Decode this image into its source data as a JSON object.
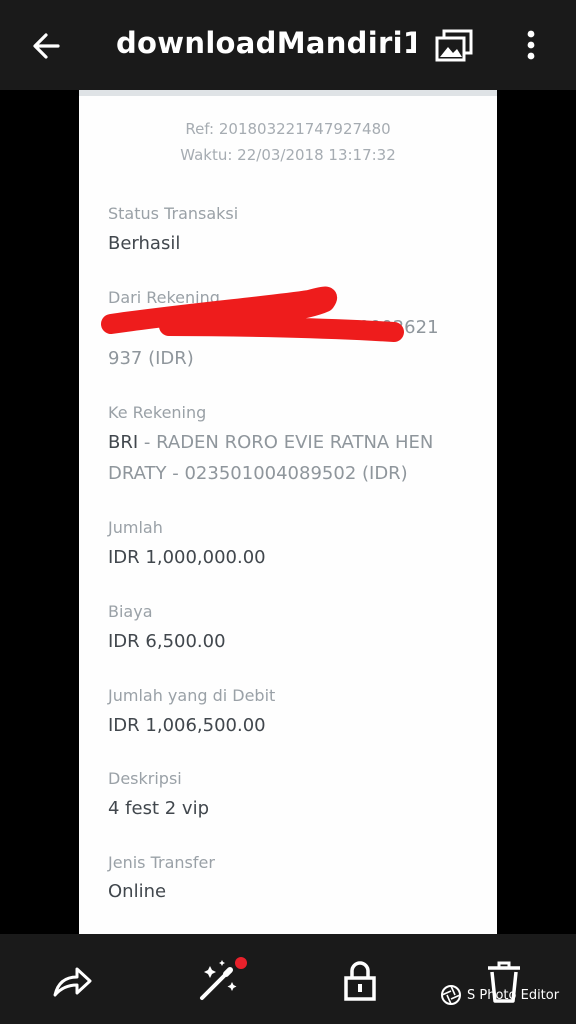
{
  "topbar": {
    "title": "downloadMandiri1...",
    "back_icon": "arrow-left-icon",
    "gallery_icon": "gallery-icon",
    "more_icon": "more-vertical-icon"
  },
  "receipt": {
    "ref": "Ref: 201803221747927480",
    "waktu": "Waktu: 22/03/2018 13:17:32",
    "fields": [
      {
        "label": "Status Transaksi",
        "value": "Berhasil"
      },
      {
        "label": "Dari Rekening",
        "value_line1": "1540002621",
        "value_line2": "937 (IDR)"
      },
      {
        "label": "Ke Rekening",
        "bank": "BRI",
        "value_line1": " - RADEN RORO EVIE RATNA HEN",
        "value_line2": "DRATY - 023501004089502 (IDR)"
      },
      {
        "label": "Jumlah",
        "value": "IDR 1,000,000.00"
      },
      {
        "label": "Biaya",
        "value": "IDR 6,500.00"
      },
      {
        "label": "Jumlah yang di Debit",
        "value": "IDR 1,006,500.00"
      },
      {
        "label": "Deskripsi",
        "value": "4 fest 2 vip"
      },
      {
        "label": "Jenis Transfer",
        "value": "Online"
      }
    ]
  },
  "bottombar": {
    "icons": [
      "share-icon",
      "magic-wand-icon",
      "lock-icon",
      "trash-icon"
    ],
    "watermark": "S Photo Editor",
    "notification_color": "#e8212b"
  },
  "colors": {
    "bar_background": "#1a1a1a",
    "redaction": "#ee1c1c"
  }
}
